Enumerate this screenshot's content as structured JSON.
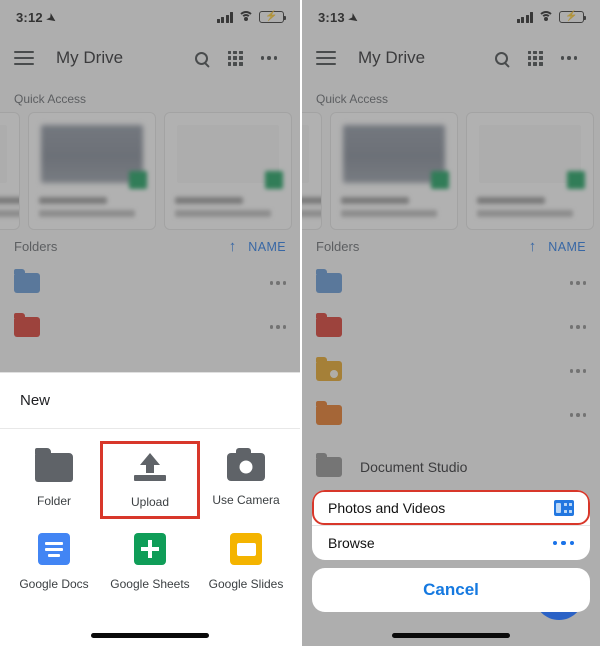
{
  "panels": [
    {
      "status": {
        "time": "3:12",
        "location_icon": "location-arrow-icon",
        "signal_icon": "cellular-signal-icon",
        "wifi_icon": "wifi-icon",
        "battery_icon": "battery-charging-icon"
      },
      "header": {
        "menu_icon": "hamburger-menu-icon",
        "title": "My Drive",
        "search_icon": "search-icon",
        "grid_icon": "grid-view-icon",
        "more_icon": "more-options-icon"
      },
      "quick_access_label": "Quick Access",
      "folders_label": "Folders",
      "sort_arrow": "↑",
      "sort_name": "NAME",
      "sheet": {
        "title": "New",
        "tiles": [
          {
            "label": "Folder",
            "icon": "folder-icon",
            "highlight": false
          },
          {
            "label": "Upload",
            "icon": "upload-icon",
            "highlight": true
          },
          {
            "label": "Use Camera",
            "icon": "camera-icon",
            "highlight": false
          },
          {
            "label": "Google Docs",
            "icon": "google-docs-icon",
            "highlight": false
          },
          {
            "label": "Google Sheets",
            "icon": "google-sheets-icon",
            "highlight": false
          },
          {
            "label": "Google Slides",
            "icon": "google-slides-icon",
            "highlight": false
          }
        ]
      }
    },
    {
      "status": {
        "time": "3:13",
        "location_icon": "location-arrow-icon",
        "signal_icon": "cellular-signal-icon",
        "wifi_icon": "wifi-icon",
        "battery_icon": "battery-charging-icon"
      },
      "header": {
        "menu_icon": "hamburger-menu-icon",
        "title": "My Drive",
        "search_icon": "search-icon",
        "grid_icon": "grid-view-icon",
        "more_icon": "more-options-icon"
      },
      "quick_access_label": "Quick Access",
      "folders_label": "Folders",
      "sort_arrow": "↑",
      "sort_name": "NAME",
      "visible_item": "Document Studio",
      "sheet": {
        "options": [
          {
            "label": "Photos and Videos",
            "trailing_icon": "photos-library-icon",
            "highlight": true
          },
          {
            "label": "Browse",
            "trailing_icon": "more-options-icon",
            "highlight": false
          }
        ],
        "cancel_label": "Cancel"
      }
    }
  ],
  "colors": {
    "highlight": "#d8372a",
    "accent_blue": "#1a73e8",
    "docs_blue": "#4285f4",
    "sheets_green": "#0f9d58",
    "slides_yellow": "#f4b400",
    "fab_blue": "#2b62c6",
    "battery_green": "#37d24a"
  }
}
